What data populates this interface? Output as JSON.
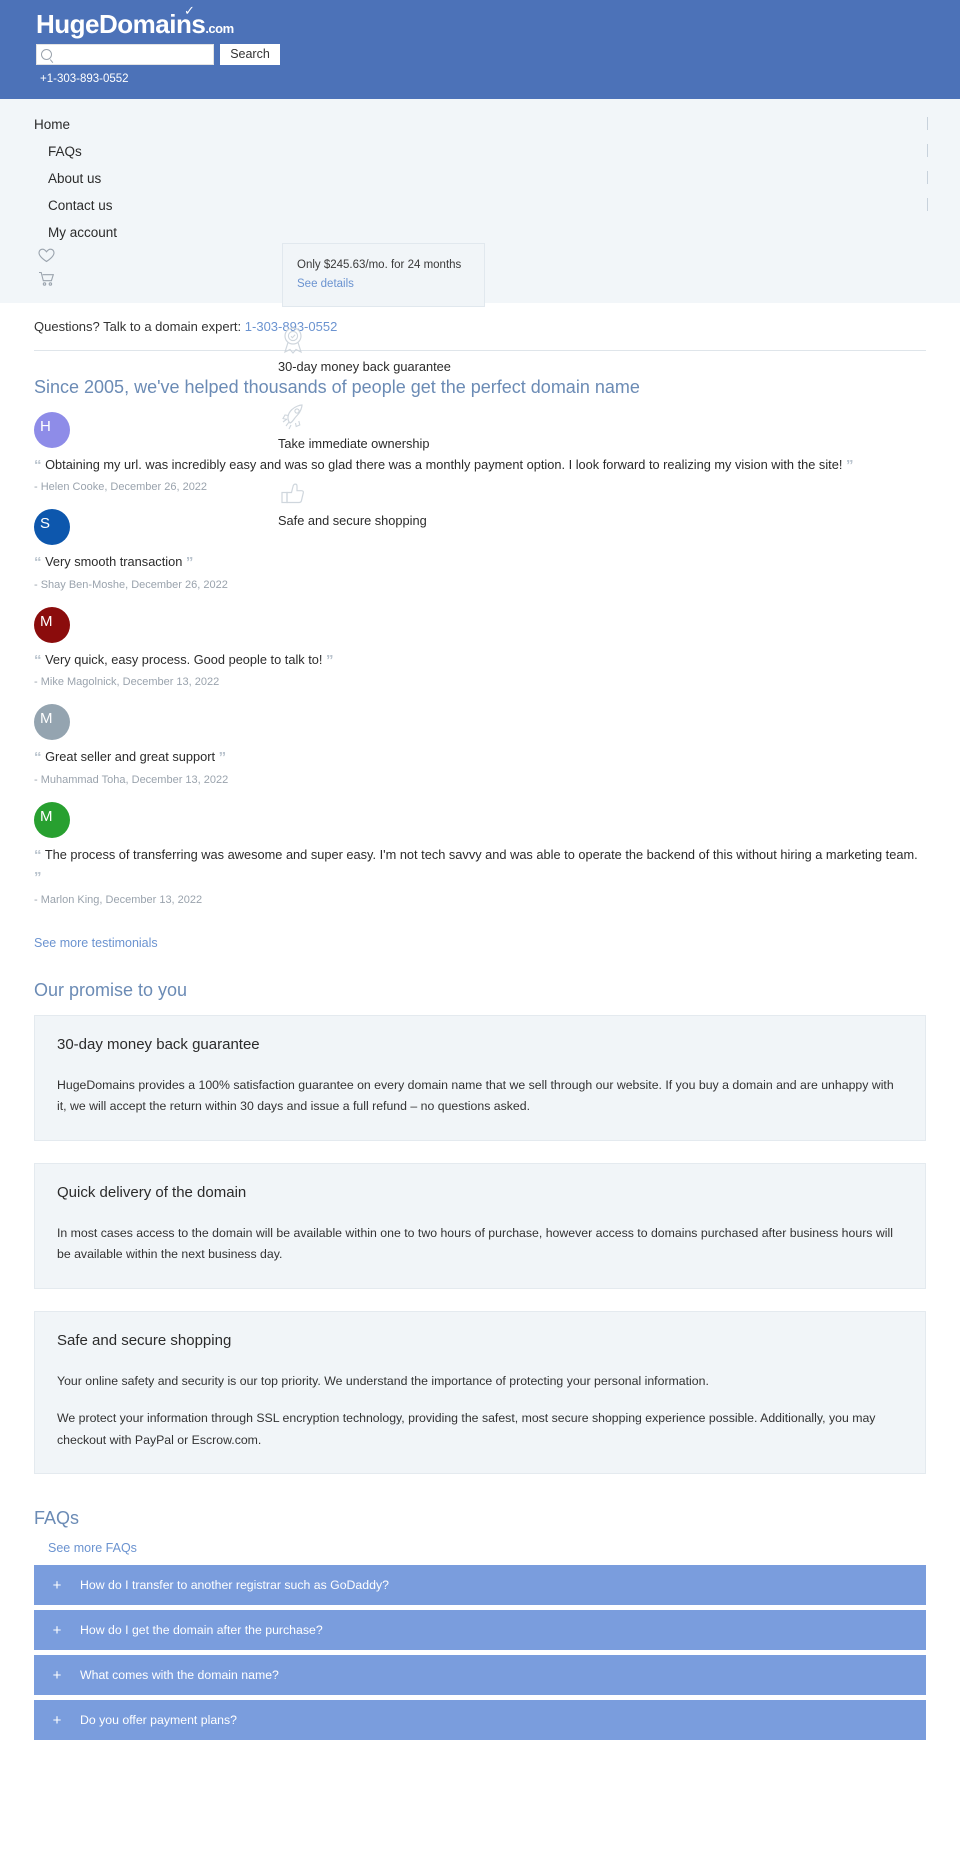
{
  "header": {
    "logo_main": "HugeDomains",
    "logo_suffix": ".com",
    "search_placeholder": "",
    "search_value": "",
    "search_button": "Search",
    "phone": "+1-303-893-0552"
  },
  "nav": {
    "items": [
      {
        "label": "Home",
        "sub": false
      },
      {
        "label": "FAQs",
        "sub": true
      },
      {
        "label": "About us",
        "sub": true
      },
      {
        "label": "Contact us",
        "sub": true
      },
      {
        "label": "My account",
        "sub": true
      }
    ],
    "icons": [
      {
        "name": "heart-icon"
      },
      {
        "name": "cart-icon"
      }
    ]
  },
  "expert": {
    "text": "Questions? Talk to a domain expert:",
    "phone": "1-303-893-0552"
  },
  "price_tooltip": {
    "text": "Only $245.63/mo. for 24 months",
    "link": "See details"
  },
  "testimonials": {
    "title": "Since 2005, we've helped thousands of people get the perfect domain name",
    "items": [
      {
        "initial": "H",
        "color": "#8e8ce8",
        "quote": "Obtaining my url. was incredibly easy and was so glad there was a monthly payment option. I look forward to realizing my vision with the site!",
        "author": "- Helen Cooke, December 26, 2022"
      },
      {
        "initial": "S",
        "color": "#0d57ad",
        "quote": "Very smooth transaction",
        "author": "- Shay Ben-Moshe, December 26, 2022"
      },
      {
        "initial": "M",
        "color": "#8b0c0c",
        "quote": "Very quick, easy process. Good people to talk to!",
        "author": "- Mike Magolnick, December 13, 2022"
      },
      {
        "initial": "M",
        "color": "#94a4b0",
        "quote": "Great seller and great support",
        "author": "- Muhammad Toha, December 13, 2022"
      },
      {
        "initial": "M",
        "color": "#28a030",
        "quote": "The process of transferring was awesome and super easy. I'm not tech savvy and was able to operate the backend of this without hiring a marketing team.",
        "author": "- Marlon King, December 13, 2022"
      }
    ],
    "more_link": "See more testimonials"
  },
  "features": [
    {
      "icon": "award-badge-icon",
      "label": "30-day money back guarantee"
    },
    {
      "icon": "rocket-icon",
      "label": "Take immediate ownership"
    },
    {
      "icon": "thumbs-up-icon",
      "label": "Safe and secure shopping"
    }
  ],
  "promise": {
    "title": "Our promise to you",
    "cards": [
      {
        "heading": "30-day money back guarantee",
        "paragraphs": [
          "HugeDomains provides a 100% satisfaction guarantee on every domain name that we sell through our website. If you buy a domain and are unhappy with it, we will accept the return within 30 days and issue a full refund – no questions asked."
        ]
      },
      {
        "heading": "Quick delivery of the domain",
        "paragraphs": [
          "In most cases access to the domain will be available within one to two hours of purchase, however access to domains purchased after business hours will be available within the next business day."
        ]
      },
      {
        "heading": "Safe and secure shopping",
        "paragraphs": [
          "Your online safety and security is our top priority. We understand the importance of protecting your personal information.",
          "We protect your information through SSL encryption technology, providing the safest, most secure shopping experience possible. Additionally, you may checkout with PayPal or Escrow.com."
        ]
      }
    ]
  },
  "faq": {
    "title": "FAQs",
    "more_link": "See more FAQs",
    "items": [
      {
        "question": "How do I transfer to another registrar such as GoDaddy?",
        "toggle": "+"
      },
      {
        "question": "How do I get the domain after the purchase?",
        "toggle": "+"
      },
      {
        "question": "What comes with the domain name?",
        "toggle": "+"
      },
      {
        "question": "Do you offer payment plans?",
        "toggle": "+"
      }
    ]
  },
  "colors": {
    "header_blue": "#4c72b8",
    "nav_bg": "#f2f6f9",
    "accent_link": "#6b93d0",
    "faq_blue": "#7a9ddd",
    "card_bg": "#f1f5f8"
  }
}
